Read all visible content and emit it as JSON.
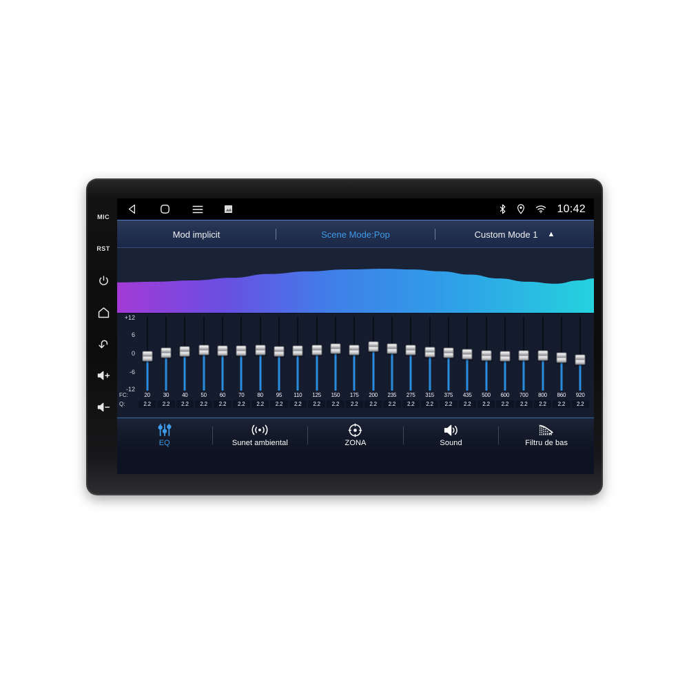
{
  "device": {
    "hardware_buttons": [
      {
        "name": "mic",
        "label": "MIC",
        "type": "text"
      },
      {
        "name": "reset",
        "label": "RST",
        "type": "text"
      },
      {
        "name": "power",
        "label": "",
        "type": "power-icon"
      },
      {
        "name": "home",
        "label": "",
        "type": "home-icon"
      },
      {
        "name": "back",
        "label": "",
        "type": "back-arrow-icon"
      },
      {
        "name": "volume-up",
        "label": "",
        "type": "volume-up-icon"
      },
      {
        "name": "volume-down",
        "label": "",
        "type": "volume-down-icon"
      }
    ]
  },
  "android_bar": {
    "nav": [
      {
        "name": "back-icon",
        "glyph": "triangle-left"
      },
      {
        "name": "home-icon",
        "glyph": "rounded-square"
      },
      {
        "name": "menu-icon",
        "glyph": "hamburger"
      },
      {
        "name": "screenshot-icon",
        "glyph": "small-image"
      }
    ],
    "status": [
      {
        "name": "bluetooth-icon"
      },
      {
        "name": "location-icon"
      },
      {
        "name": "wifi-icon"
      }
    ],
    "clock": "10:42"
  },
  "mode_bar": {
    "default_mode": "Mod implicit",
    "scene_mode": "Scene Mode:Pop",
    "custom_mode": "Custom Mode 1",
    "expand_glyph": "▲",
    "active_color": "#3f9ae8"
  },
  "spectrum": {
    "gradient_stops": [
      "#a33ad6",
      "#5b52e0",
      "#3a7fe8",
      "#2fb6e8",
      "#25d0e0"
    ],
    "background": "#1a2236"
  },
  "equalizer": {
    "axis_labels": [
      "+12",
      "6",
      "0",
      "-6",
      "-12"
    ],
    "axis_range": [
      -12,
      12
    ],
    "fc_row_label": "FC:",
    "q_row_label": "Q:",
    "bands": [
      {
        "fc": "20",
        "q": "2.2",
        "gain": -0.6
      },
      {
        "fc": "30",
        "q": "2.2",
        "gain": 0.4
      },
      {
        "fc": "40",
        "q": "2.2",
        "gain": 0.9
      },
      {
        "fc": "50",
        "q": "2.2",
        "gain": 1.4
      },
      {
        "fc": "60",
        "q": "2.2",
        "gain": 1.1
      },
      {
        "fc": "70",
        "q": "2.2",
        "gain": 1.2
      },
      {
        "fc": "80",
        "q": "2.2",
        "gain": 1.3
      },
      {
        "fc": "95",
        "q": "2.2",
        "gain": 1.0
      },
      {
        "fc": "110",
        "q": "2.2",
        "gain": 1.2
      },
      {
        "fc": "125",
        "q": "2.2",
        "gain": 1.4
      },
      {
        "fc": "150",
        "q": "2.2",
        "gain": 1.8
      },
      {
        "fc": "175",
        "q": "2.2",
        "gain": 1.5
      },
      {
        "fc": "200",
        "q": "2.2",
        "gain": 2.6
      },
      {
        "fc": "235",
        "q": "2.2",
        "gain": 1.9
      },
      {
        "fc": "275",
        "q": "2.2",
        "gain": 1.5
      },
      {
        "fc": "315",
        "q": "2.2",
        "gain": 0.6
      },
      {
        "fc": "375",
        "q": "2.2",
        "gain": 0.5
      },
      {
        "fc": "435",
        "q": "2.2",
        "gain": -0.1
      },
      {
        "fc": "500",
        "q": "2.2",
        "gain": -0.5
      },
      {
        "fc": "600",
        "q": "2.2",
        "gain": -0.7
      },
      {
        "fc": "700",
        "q": "2.2",
        "gain": -0.4
      },
      {
        "fc": "800",
        "q": "2.2",
        "gain": -0.5
      },
      {
        "fc": "860",
        "q": "2.2",
        "gain": -1.2
      },
      {
        "fc": "920",
        "q": "2.2",
        "gain": -1.9
      }
    ]
  },
  "tabs": [
    {
      "name": "eq",
      "label": "EQ",
      "icon": "equalizer-sliders-icon",
      "active": true
    },
    {
      "name": "ambient",
      "label": "Sunet ambiental",
      "icon": "surround-waves-icon",
      "active": false
    },
    {
      "name": "zone",
      "label": "ZONA",
      "icon": "target-zone-icon",
      "active": false
    },
    {
      "name": "sound",
      "label": "Sound",
      "icon": "speaker-icon",
      "active": false
    },
    {
      "name": "bassfilter",
      "label": "Filtru de bas",
      "icon": "bass-filter-icon",
      "active": false
    }
  ]
}
